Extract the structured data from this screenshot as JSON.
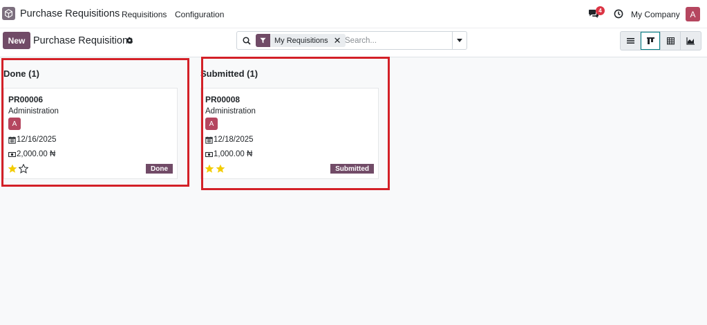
{
  "navbar": {
    "app_name": "Purchase Requisitions",
    "menu": [
      "Requisitions",
      "Configuration"
    ],
    "chat_count": "4",
    "company": "My Company",
    "user_initial": "A"
  },
  "control_panel": {
    "new_label": "New",
    "title": "Purchase Requisitions",
    "facet_value": "My Requisitions",
    "facet_remove": "✕",
    "search_placeholder": "Search..."
  },
  "columns": [
    {
      "header": "Done (1)",
      "card": {
        "ref": "PR00006",
        "department": "Administration",
        "avatar": "A",
        "date": "12/16/2025",
        "amount": "2,000.00 ₦",
        "stars_filled": 1,
        "stars_total": 2,
        "state": "Done"
      }
    },
    {
      "header": "Submitted (1)",
      "card": {
        "ref": "PR00008",
        "department": "Administration",
        "avatar": "A",
        "date": "12/18/2025",
        "amount": "1,000.00 ₦",
        "stars_filled": 2,
        "stars_total": 2,
        "state": "Submitted"
      }
    }
  ],
  "colors": {
    "brand": "#714b67",
    "avatar": "#b5465f",
    "star": "#f3cc00",
    "highlight": "#d32027"
  }
}
